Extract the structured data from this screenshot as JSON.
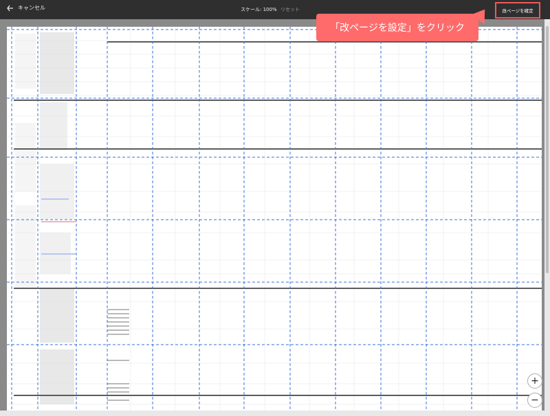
{
  "toolbar": {
    "cancel_label": "キャンセル",
    "scale_label": "スケール: 100%",
    "reset_label": "リセット",
    "confirm_label": "改ページを確定"
  },
  "callout": {
    "text": "「改ページを設定」をクリック"
  },
  "zoom": {
    "in_symbol": "+",
    "out_symbol": "−"
  },
  "colors": {
    "bar": "#2f2f2f",
    "highlight": "#f05a5a",
    "callout": "#ff6b6b",
    "guide": "#3a6fd8"
  }
}
